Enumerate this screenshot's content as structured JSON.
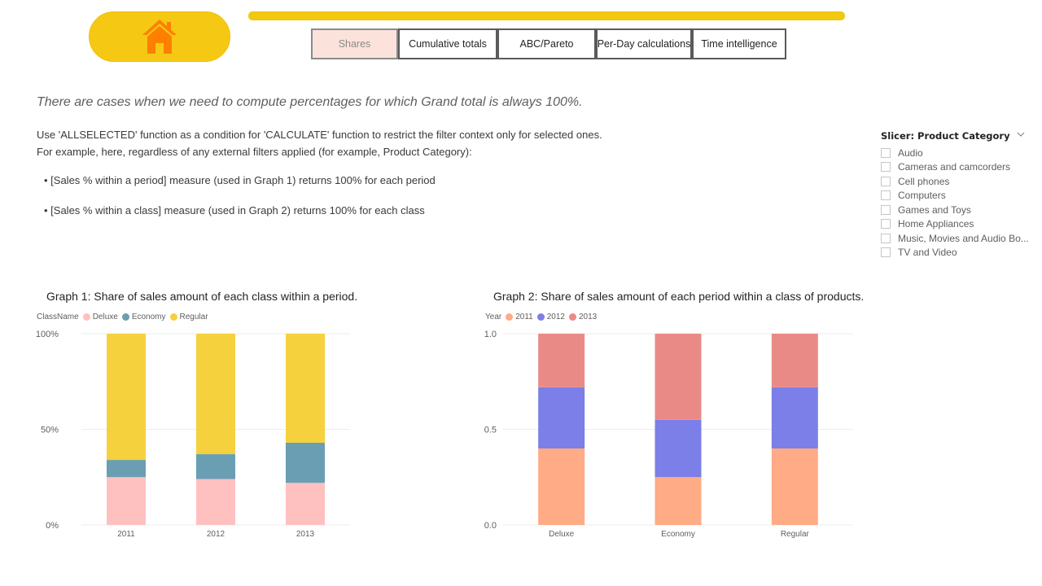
{
  "header": {
    "home_icon": "house-icon",
    "home_color": "#FF7F00",
    "accent_color": "#F2C811",
    "tabs": [
      {
        "label": "Shares",
        "active": true
      },
      {
        "label": "Cumulative totals",
        "active": false
      },
      {
        "label": "ABC/Pareto",
        "active": false
      },
      {
        "label": "Per-Day calculations",
        "active": false
      },
      {
        "label": "Time intelligence",
        "active": false
      }
    ]
  },
  "content": {
    "subtitle": "There are cases when we need to compute percentages for which Grand total is always 100%.",
    "desc_line1": "Use 'ALLSELECTED' function as a condition for 'CALCULATE' function to restrict the filter context only for selected ones.",
    "desc_line2": "For example, here, regardless of any external filters applied (for example, Product Category):",
    "bullet1": "• [Sales % within a period] measure (used in Graph 1) returns 100% for each period",
    "bullet2": "• [Sales % within a class] measure (used in Graph 2) returns 100% for each class"
  },
  "slicer": {
    "title": "Slicer: Product Category",
    "chevron_icon": "chevron-down-icon",
    "items": [
      "Audio",
      "Cameras and camcorders",
      "Cell phones",
      "Computers",
      "Games and Toys",
      "Home Appliances",
      "Music, Movies and Audio Bo...",
      "TV and Video"
    ]
  },
  "chart_data": [
    {
      "type": "bar",
      "stacked": true,
      "title": "Graph 1: Share of sales amount of each class within a period.",
      "legend_title": "ClassName",
      "legend_position": "top-left",
      "categories": [
        "2011",
        "2012",
        "2013"
      ],
      "series": [
        {
          "name": "Deluxe",
          "color": "#FFC0C0",
          "values": [
            0.25,
            0.24,
            0.22
          ]
        },
        {
          "name": "Economy",
          "color": "#6A9EB3",
          "values": [
            0.09,
            0.13,
            0.21
          ]
        },
        {
          "name": "Regular",
          "color": "#F5D13D",
          "values": [
            0.66,
            0.63,
            0.57
          ]
        }
      ],
      "ylim": [
        0,
        1
      ],
      "yticks": [
        0,
        0.5,
        1
      ],
      "ytick_labels": [
        "0%",
        "50%",
        "100%"
      ],
      "grid": true
    },
    {
      "type": "bar",
      "stacked": true,
      "title": "Graph 2: Share of sales amount of each period within a class of products.",
      "legend_title": "Year",
      "legend_position": "top-left",
      "categories": [
        "Deluxe",
        "Economy",
        "Regular"
      ],
      "series": [
        {
          "name": "2011",
          "color": "#FFAB86",
          "values": [
            0.4,
            0.25,
            0.4
          ]
        },
        {
          "name": "2012",
          "color": "#7B7FE7",
          "values": [
            0.32,
            0.3,
            0.32
          ]
        },
        {
          "name": "2013",
          "color": "#EA8A86",
          "values": [
            0.28,
            0.45,
            0.28
          ]
        }
      ],
      "ylim": [
        0,
        1
      ],
      "yticks": [
        0,
        0.5,
        1
      ],
      "ytick_labels": [
        "0.0",
        "0.5",
        "1.0"
      ],
      "grid": true
    }
  ]
}
